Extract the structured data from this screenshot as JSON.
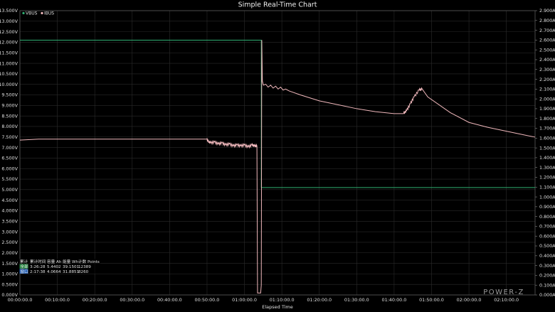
{
  "window": {
    "title": "Simple Real-Time Chart"
  },
  "brand": "POWER-Z",
  "colors": {
    "vbus": "#2fae72",
    "ibus": "#f0b8bc",
    "background": "#000000",
    "grid": "#2b2b2b",
    "stats_row1_tag": "#2a8a46",
    "stats_row2_tag": "#2a64b8"
  },
  "stats_table": {
    "headers": [
      "累计",
      "累计时间",
      "容量 Ah",
      "能量 Wh",
      "计数 Points"
    ],
    "rows": [
      [
        "全部",
        "3:26:28",
        "5.4402",
        "39.1501",
        "12389"
      ],
      [
        "窗口",
        "2:17:38",
        "4.0664",
        "31.8851",
        "8260"
      ]
    ]
  },
  "chart_data": {
    "type": "line",
    "title": "Simple Real-Time Chart",
    "xlabel": "Elapsed Time",
    "x_unit": "seconds",
    "xlim": [
      0,
      8260
    ],
    "x_ticks": [
      "00:00:00.0",
      "00:10:00.0",
      "00:20:00.0",
      "00:30:00.0",
      "00:40:00.0",
      "00:50:00.0",
      "01:00:00.0",
      "01:10:00.0",
      "01:20:00.0",
      "01:30:00.0",
      "01:40:00.0",
      "01:50:00.0",
      "02:00:00.0",
      "02:10:00.0"
    ],
    "y_left": {
      "lim": [
        0,
        13.5
      ],
      "ticks": [
        "0.000V",
        "0.500V",
        "1.000V",
        "1.500V",
        "2.000V",
        "2.500V",
        "3.000V",
        "3.500V",
        "4.000V",
        "4.500V",
        "5.000V",
        "5.500V",
        "6.000V",
        "6.500V",
        "7.000V",
        "7.500V",
        "8.000V",
        "8.500V",
        "9.000V",
        "9.500V",
        "10.000V",
        "10.500V",
        "11.000V",
        "11.500V",
        "12.000V",
        "12.500V",
        "13.000V",
        "13.500V"
      ]
    },
    "y_right": {
      "lim": [
        0,
        2.9
      ],
      "ticks": [
        "0.000A",
        "0.100A",
        "0.200A",
        "0.300A",
        "0.400A",
        "0.500A",
        "0.600A",
        "0.700A",
        "0.800A",
        "0.900A",
        "1.000A",
        "1.100A",
        "1.200A",
        "1.300A",
        "1.400A",
        "1.500A",
        "1.600A",
        "1.700A",
        "1.800A",
        "1.900A",
        "2.000A",
        "2.100A",
        "2.200A",
        "2.300A",
        "2.400A",
        "2.500A",
        "2.600A",
        "2.700A",
        "2.800A",
        "2.900A"
      ]
    },
    "grid": true,
    "legend_position": "top-left",
    "series": [
      {
        "name": "VBUS",
        "axis": "left",
        "color": "#2fae72",
        "points": [
          [
            0,
            12.1
          ],
          [
            3870,
            12.1
          ],
          [
            3870,
            5.1
          ],
          [
            8260,
            5.1
          ]
        ]
      },
      {
        "name": "IBUS",
        "axis": "right",
        "color": "#f0b8bc",
        "points": [
          [
            0,
            1.58
          ],
          [
            300,
            1.59
          ],
          [
            1200,
            1.59
          ],
          [
            2400,
            1.59
          ],
          [
            3000,
            1.59
          ],
          [
            3010,
            1.57
          ],
          [
            3060,
            1.55
          ],
          [
            3120,
            1.56
          ],
          [
            3180,
            1.54
          ],
          [
            3240,
            1.55
          ],
          [
            3300,
            1.53
          ],
          [
            3360,
            1.54
          ],
          [
            3420,
            1.52
          ],
          [
            3480,
            1.53
          ],
          [
            3540,
            1.52
          ],
          [
            3600,
            1.53
          ],
          [
            3660,
            1.51
          ],
          [
            3720,
            1.53
          ],
          [
            3760,
            1.52
          ],
          [
            3800,
            1.52
          ],
          [
            3810,
            0.02
          ],
          [
            3860,
            0.02
          ],
          [
            3870,
            0.1
          ],
          [
            3878,
            2.6
          ],
          [
            3888,
            2.18
          ],
          [
            3905,
            2.14
          ],
          [
            3940,
            2.15
          ],
          [
            3980,
            2.12
          ],
          [
            4020,
            2.14
          ],
          [
            4060,
            2.11
          ],
          [
            4100,
            2.13
          ],
          [
            4140,
            2.1
          ],
          [
            4180,
            2.12
          ],
          [
            4220,
            2.09
          ],
          [
            4260,
            2.1
          ],
          [
            4320,
            2.08
          ],
          [
            4500,
            2.04
          ],
          [
            4800,
            1.98
          ],
          [
            5100,
            1.94
          ],
          [
            5400,
            1.9
          ],
          [
            5700,
            1.87
          ],
          [
            6000,
            1.85
          ],
          [
            6150,
            1.85
          ],
          [
            6200,
            1.88
          ],
          [
            6260,
            1.95
          ],
          [
            6320,
            2.02
          ],
          [
            6400,
            2.09
          ],
          [
            6450,
            2.1
          ],
          [
            6540,
            2.02
          ],
          [
            6900,
            1.86
          ],
          [
            7200,
            1.76
          ],
          [
            7500,
            1.71
          ],
          [
            7800,
            1.67
          ],
          [
            8100,
            1.63
          ],
          [
            8260,
            1.61
          ]
        ]
      }
    ]
  }
}
